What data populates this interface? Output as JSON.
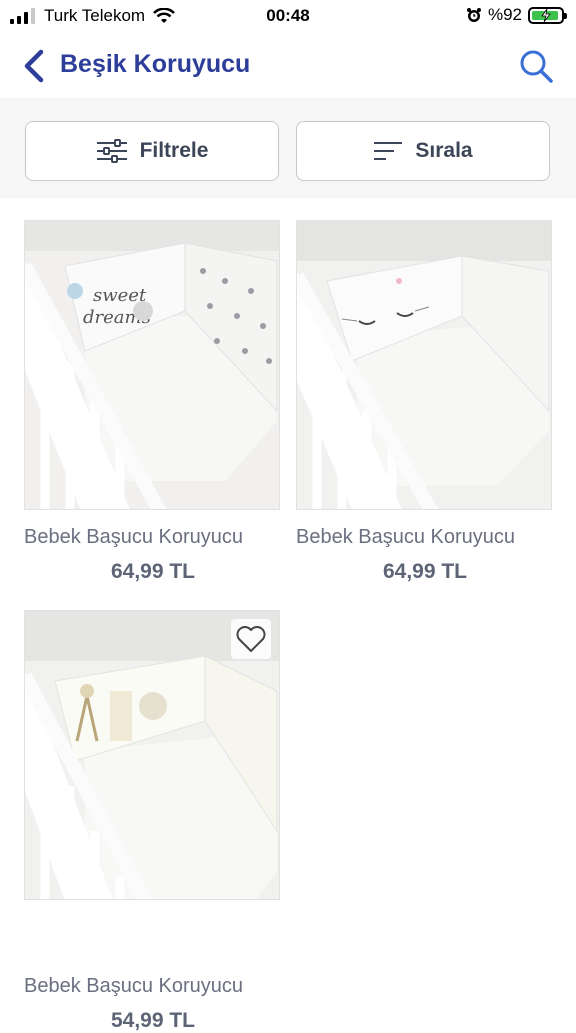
{
  "status": {
    "carrier": "Turk Telekom",
    "time": "00:48",
    "battery": "%92"
  },
  "nav": {
    "title": "Beşik Koruyucu"
  },
  "filters": {
    "filter_label": "Filtrele",
    "sort_label": "Sırala"
  },
  "products": [
    {
      "name": "Bebek Başucu Koruyucu",
      "price": "64,99 TL",
      "pillow_text": "sweet dreams"
    },
    {
      "name": "Bebek Başucu Koruyucu",
      "price": "64,99 TL"
    },
    {
      "name": "Bebek Başucu Koruyucu",
      "price": "54,99 TL"
    }
  ],
  "colors": {
    "brand": "#2d3e9a",
    "accent": "#3a6fd8",
    "price": "#5d6476"
  }
}
